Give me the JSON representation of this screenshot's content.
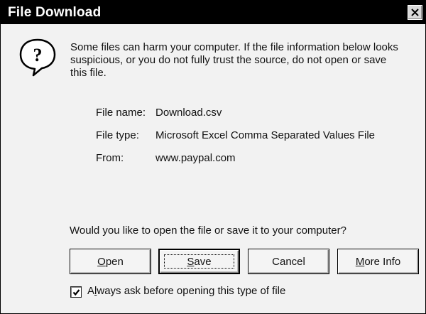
{
  "window": {
    "title": "File Download"
  },
  "icons": {
    "question": "question-mark-icon",
    "close": "close-icon",
    "check": "checkmark-icon"
  },
  "message": "Some files can harm your computer. If the file information below looks suspicious, or you do not fully trust the source, do not open or save this file.",
  "file_info": {
    "name_label": "File name:",
    "name_value": "Download.csv",
    "type_label": "File type:",
    "type_value": "Microsoft Excel Comma Separated Values File",
    "from_label": "From:",
    "from_value": "www.paypal.com"
  },
  "question": "Would you like to open the file or save it to your computer?",
  "buttons": {
    "open": "Open",
    "save": "Save",
    "cancel": "Cancel",
    "more_info": "More Info"
  },
  "checkbox": {
    "label": "Always ask before opening this type of file",
    "checked": true
  },
  "colors": {
    "titlebar": "#000000",
    "dialog_bg": "#f2f2f2"
  }
}
